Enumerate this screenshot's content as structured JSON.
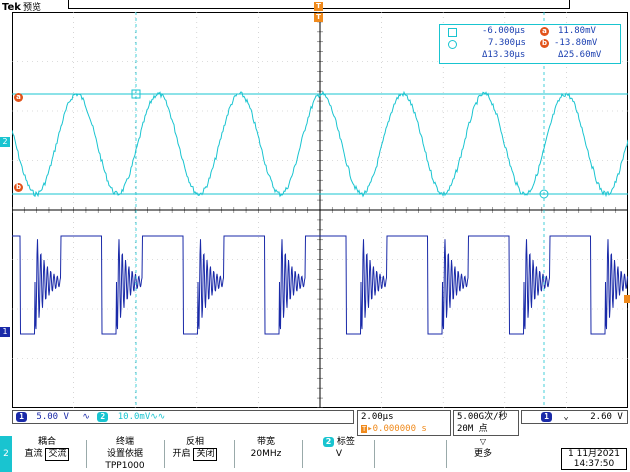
{
  "brand": {
    "name": "Tek",
    "mode": "预览"
  },
  "cursors": {
    "row1": {
      "time": "-6.000µs",
      "volt": "11.80mV"
    },
    "row2": {
      "time": "7.300µs",
      "volt": "-13.80mV"
    },
    "row3": {
      "time": "Δ13.30µs",
      "volt": "Δ25.60mV"
    },
    "marker_a": "a",
    "marker_b": "b"
  },
  "channel_markers": {
    "ch1": "1",
    "ch2": "2",
    "trigger": "T"
  },
  "status": {
    "ch1_num": "1",
    "ch1_scale": "5.00 V",
    "ch1_bw_symbol": "∿",
    "ch2_num": "2",
    "ch2_scale": "10.0mV",
    "ch2_bw_symbol": "∿∿",
    "timebase": "2.00µs",
    "trigger_pos_marker": "T",
    "trigger_pos": "▸0.000000 s",
    "sample_rate": "5.00G次/秒",
    "record_length": "20M 点",
    "trig_ch": "1",
    "trig_slope": "⌄",
    "trig_level": "2.60 V"
  },
  "menu": {
    "ch_tab": "2",
    "coupling_title": "耦合",
    "coupling_opt1": "直流",
    "coupling_opt2": "交流",
    "termination_title1": "终端",
    "termination_title2": "设置依据",
    "termination_value": "TPP1000",
    "invert_title": "反相",
    "invert_opt1": "开启",
    "invert_opt2": "关闭",
    "bandwidth_title": "带宽",
    "bandwidth_value": "20MHz",
    "label_badge": "2",
    "label_title": "标签",
    "label_value": "V",
    "more_title": "更多",
    "date": "1 11月2021",
    "time": "14:37:50"
  },
  "colors": {
    "ch1": "#1a2aa8",
    "ch2": "#19c4d0",
    "cursor": "#19c4d0",
    "marker": "#e2531a",
    "trigger": "#f08a1c"
  }
}
